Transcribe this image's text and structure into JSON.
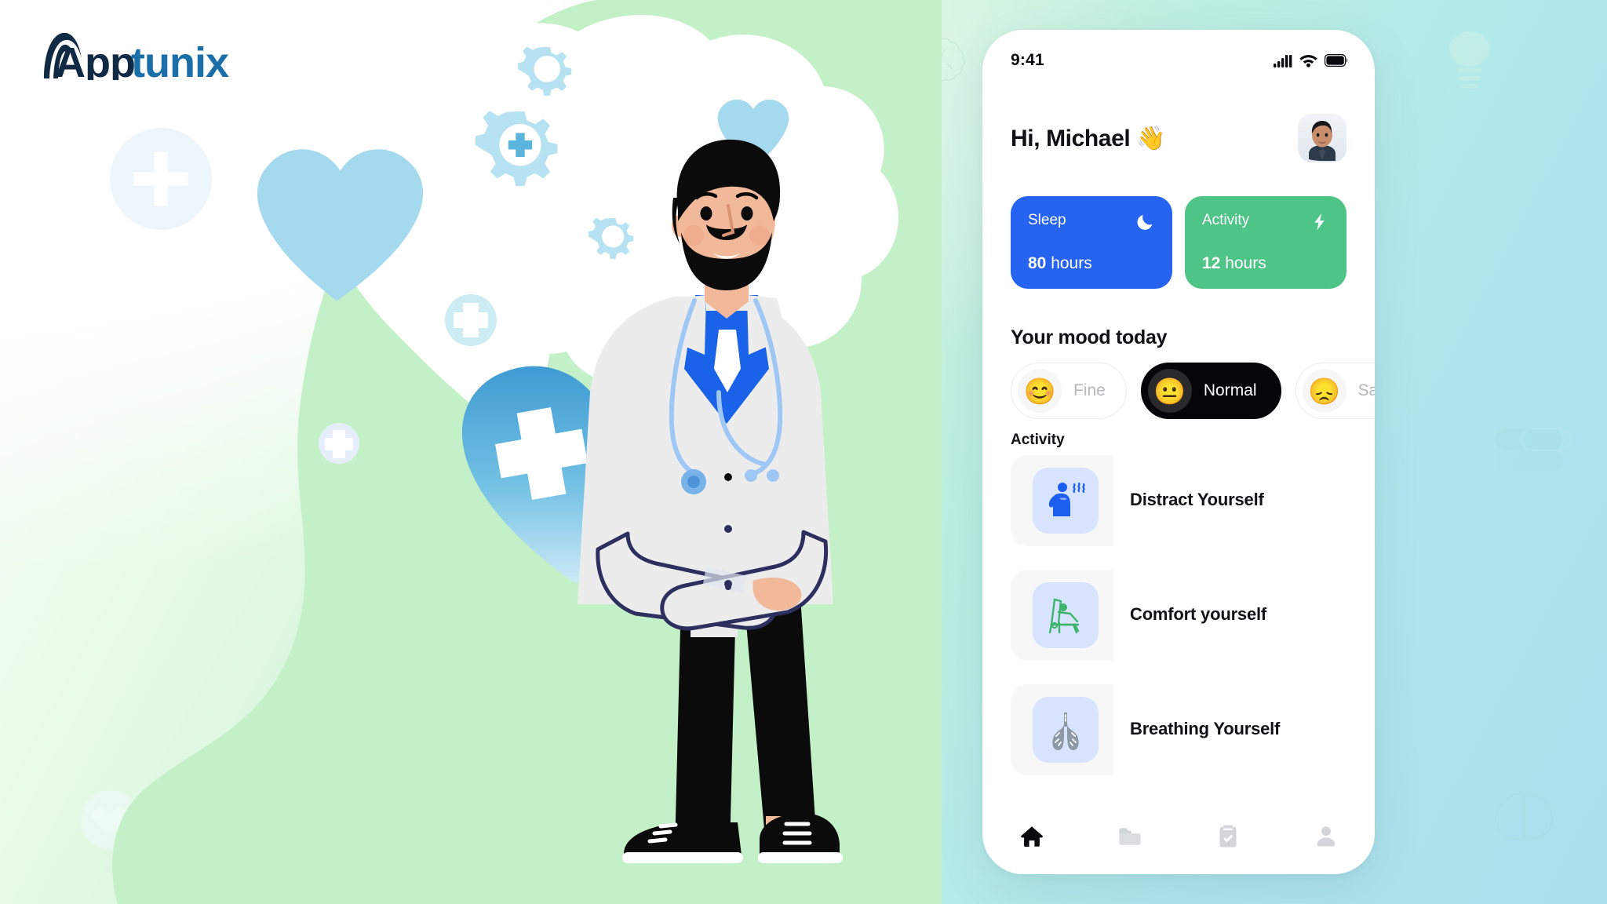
{
  "brand": {
    "logo_text_dark": "App",
    "logo_text_light": "tunix",
    "color_dark": "#102a43",
    "color_light": "#1b6fa8"
  },
  "background": {
    "gradient_from": "#ffffff",
    "gradient_mid": "#cdf3d6",
    "gradient_to": "#aadfeb",
    "head_silhouette_color": "#c4f0c8",
    "cloud_color": "#ffffff",
    "watermark_icons": [
      "brain-icon",
      "lightbulb-icon",
      "pill-icon",
      "brain-icon",
      "heart-icon",
      "plus-icon"
    ]
  },
  "illustration": {
    "name": "doctor-with-mind-cloud",
    "icons": [
      "gear-icon",
      "gear-icon",
      "gear-icon",
      "plus-icon",
      "plus-icon",
      "plus-icon",
      "heart-icon",
      "heart-icon",
      "heart-cross-icon"
    ],
    "coat_color": "#ececec",
    "shirt_color": "#1a62e8",
    "pants_color": "#0b0b0b",
    "skin_color": "#f2b89a",
    "heart_gradient_from": "#4a9ed1",
    "heart_gradient_to": "#c7e9f5",
    "gear_color": "#b7e2f1",
    "light_heart_color": "#a4d9ee"
  },
  "phone": {
    "status_bar": {
      "time": "9:41",
      "icons": [
        "cellular-signal-icon",
        "wifi-icon",
        "battery-icon"
      ]
    },
    "header": {
      "greeting": "Hi, Michael 👋",
      "avatar_name": "avatar"
    },
    "stats": [
      {
        "label": "Sleep",
        "value": "80",
        "unit": "hours",
        "icon": "moon-icon",
        "color": "#2563f0"
      },
      {
        "label": "Activity",
        "value": "12",
        "unit": "hours",
        "icon": "lightning-icon",
        "color": "#4ec486"
      }
    ],
    "mood": {
      "title": "Your mood today",
      "options": [
        {
          "label": "Fine",
          "emoji": "😊",
          "selected": false
        },
        {
          "label": "Normal",
          "emoji": "😐",
          "selected": true
        },
        {
          "label": "Sad",
          "emoji": "😞",
          "selected": false
        }
      ]
    },
    "activity": {
      "title": "Activity",
      "items": [
        {
          "label": "Distract Yourself",
          "icon": "person-stress-icon",
          "icon_color": "#2563f0"
        },
        {
          "label": "Comfort yourself",
          "icon": "person-relax-icon",
          "icon_color": "#3cb46c"
        },
        {
          "label": "Breathing Yourself",
          "icon": "lungs-icon",
          "icon_color": "#8d9aa6"
        }
      ]
    },
    "nav": [
      {
        "name": "home",
        "icon": "home-icon",
        "active": true
      },
      {
        "name": "folder",
        "icon": "folder-icon",
        "active": false
      },
      {
        "name": "tasks",
        "icon": "clipboard-check-icon",
        "active": false
      },
      {
        "name": "profile",
        "icon": "person-icon",
        "active": false
      }
    ]
  }
}
